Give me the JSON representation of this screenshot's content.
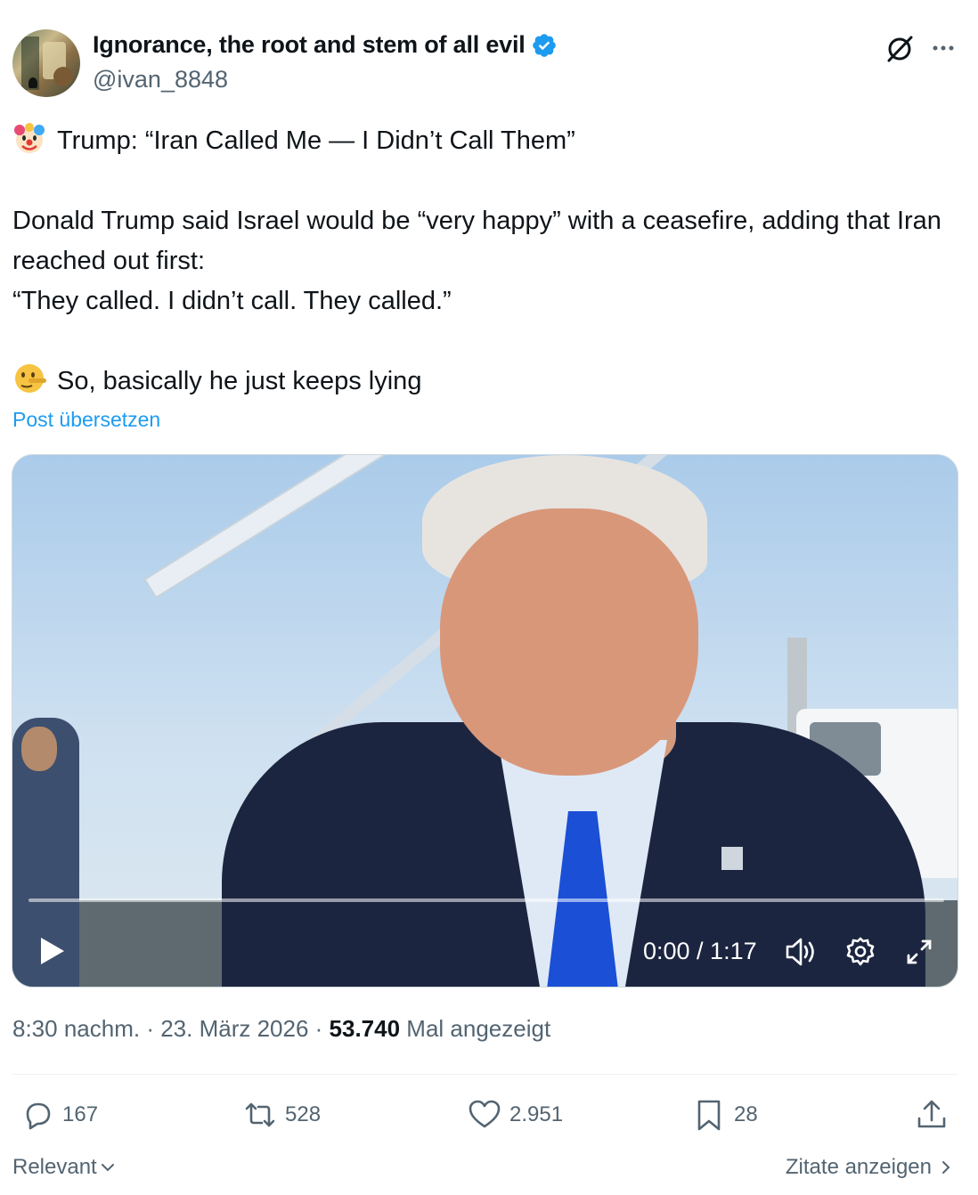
{
  "author": {
    "display_name": "Ignorance, the root and stem of all evil",
    "handle": "@ivan_8848",
    "verified": true
  },
  "tweet": {
    "lines": [
      "Trump: “Iran Called Me — I Didn’t Call Them”",
      "",
      "Donald Trump said Israel would be “very happy” with a ceasefire, adding that Iran reached out first:",
      "“They called. I didn’t call. They called.”",
      "",
      "So, basically he just keeps lying"
    ],
    "emoji_1": "clown-face-emoji",
    "emoji_2": "lying-face-emoji",
    "translate_label": "Post übersetzen"
  },
  "video": {
    "current_time": "0:00",
    "duration": "1:17",
    "time_display": "0:00 / 1:17",
    "progress": 0
  },
  "meta": {
    "time": "8:30 nachm.",
    "separator": " · ",
    "date": "23. März 2026",
    "views": "53.740",
    "views_label": " Mal angezeigt"
  },
  "actions": {
    "replies": "167",
    "reposts": "528",
    "likes": "2.951",
    "bookmarks": "28"
  },
  "footer": {
    "sort_label": "Relevant",
    "quotes_label": "Zitate anzeigen"
  },
  "colors": {
    "accent": "#1d9bf0",
    "text": "#0f1419",
    "secondary": "#536471"
  }
}
